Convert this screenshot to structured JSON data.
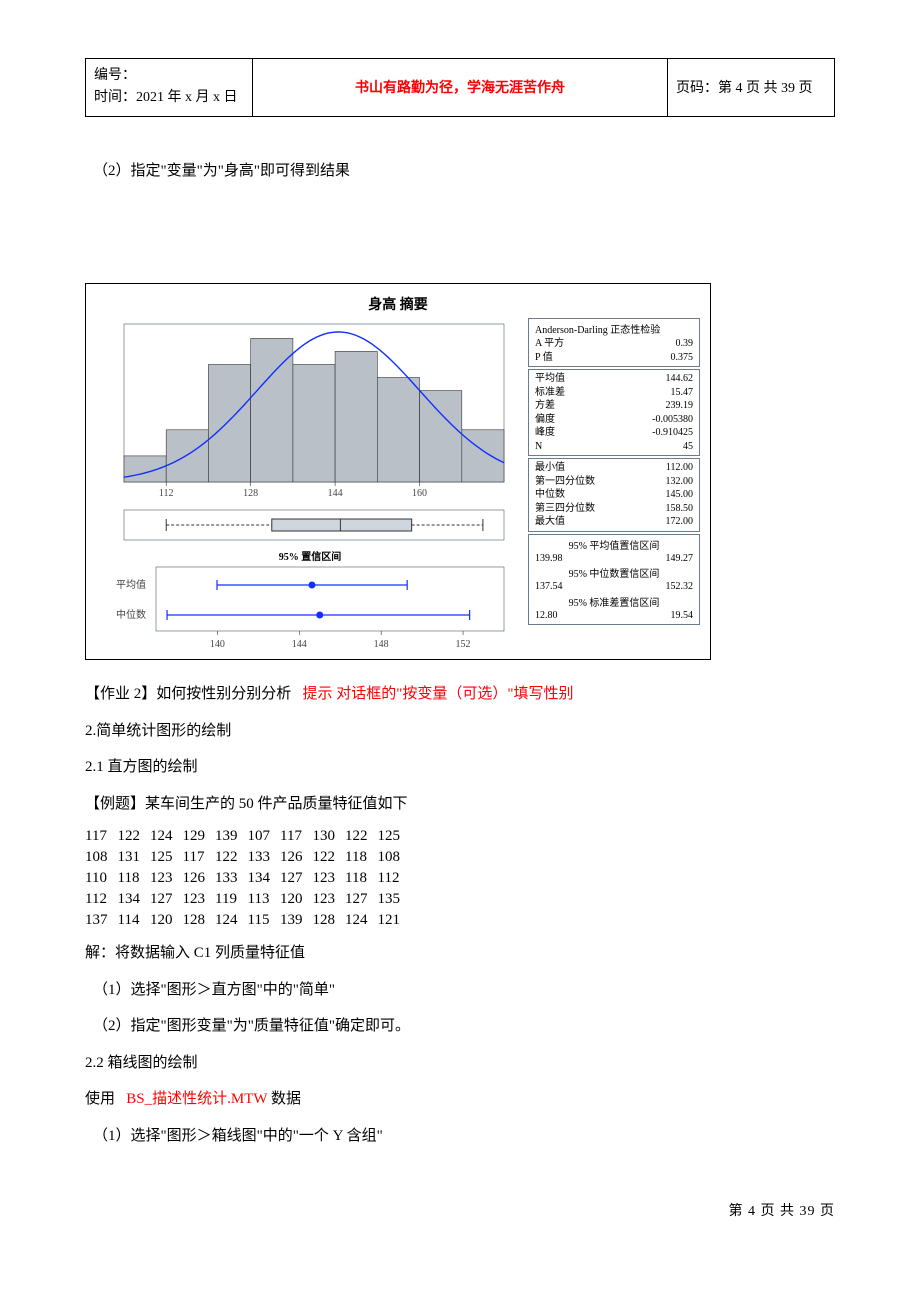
{
  "header": {
    "serial_label": "编号：",
    "time_label": "时间：2021 年 x 月 x 日",
    "banner": "书山有路勤为径，学海无涯苦作舟",
    "page_label": "页码：第 4 页 共 39 页"
  },
  "line_step2": "（2）指定\"变量\"为\"身高\"即可得到结果",
  "chart_data": {
    "type": "bar",
    "title": "身高  摘要",
    "x_ticks": [
      112,
      128,
      144,
      160
    ],
    "categories": [
      108,
      116,
      124,
      132,
      140,
      148,
      156,
      164,
      172
    ],
    "values": [
      2,
      4,
      9,
      11,
      9,
      10,
      8,
      7,
      4
    ],
    "curve_overlay": true,
    "boxplot": {
      "min": 112,
      "q1": 132,
      "median": 145,
      "q3": 158.5,
      "max": 172
    },
    "ci_section_title": "95% 置信区间",
    "ci_xticks": [
      140,
      144,
      148,
      152
    ],
    "ci_rows": [
      {
        "label": "平均值",
        "low": 139.98,
        "point": 144.62,
        "high": 149.27
      },
      {
        "label": "中位数",
        "low": 137.54,
        "point": 145.0,
        "high": 152.32
      }
    ],
    "stats": {
      "ad_title": "Anderson-Darling 正态性检验",
      "rows1": [
        {
          "k": "A 平方",
          "v": "0.39"
        },
        {
          "k": "P 值",
          "v": "0.375"
        }
      ],
      "rows2": [
        {
          "k": "平均值",
          "v": "144.62"
        },
        {
          "k": "标准差",
          "v": "15.47"
        },
        {
          "k": "方差",
          "v": "239.19"
        },
        {
          "k": "偏度",
          "v": "-0.005380"
        },
        {
          "k": "峰度",
          "v": "-0.910425"
        },
        {
          "k": "N",
          "v": "45"
        }
      ],
      "rows3": [
        {
          "k": "最小值",
          "v": "112.00"
        },
        {
          "k": "第一四分位数",
          "v": "132.00"
        },
        {
          "k": "中位数",
          "v": "145.00"
        },
        {
          "k": "第三四分位数",
          "v": "158.50"
        },
        {
          "k": "最大值",
          "v": "172.00"
        }
      ],
      "ci_blocks": [
        {
          "title": "95% 平均值置信区间",
          "low": "139.98",
          "high": "149.27"
        },
        {
          "title": "95% 中位数置信区间",
          "low": "137.54",
          "high": "152.32"
        },
        {
          "title": "95% 标准差置信区间",
          "low": "12.80",
          "high": "19.54"
        }
      ]
    }
  },
  "hw2_prefix": "【作业 2】如何按性别分别分析",
  "hw2_hint": "提示 对话框的\"按变量（可选）\"填写性别",
  "sec2": "2.简单统计图形的绘制",
  "sec21": "2.1 直方图的绘制",
  "example_title": "【例题】某车间生产的 50 件产品质量特征值如下",
  "data_rows": [
    [
      117,
      122,
      124,
      129,
      139,
      107,
      117,
      130,
      122,
      125
    ],
    [
      108,
      131,
      125,
      117,
      122,
      133,
      126,
      122,
      118,
      108
    ],
    [
      110,
      118,
      123,
      126,
      133,
      134,
      127,
      123,
      118,
      112
    ],
    [
      112,
      134,
      127,
      123,
      119,
      113,
      120,
      123,
      127,
      135
    ],
    [
      137,
      114,
      120,
      128,
      124,
      115,
      139,
      128,
      124,
      121
    ]
  ],
  "sol_intro": "解：将数据输入 C1 列质量特征值",
  "sol_step1": "（1）选择\"图形＞直方图\"中的\"简单\"",
  "sol_step2": "（2）指定\"图形变量\"为\"质量特征值\"确定即可。",
  "sec22": "2.2 箱线图的绘制",
  "use_prefix": "使用",
  "use_file": "BS_描述性统计.MTW",
  "use_suffix": "数据",
  "box_step1": "（1）选择\"图形＞箱线图\"中的\"一个 Y 含组\"",
  "footer": "第 4 页 共 39 页"
}
